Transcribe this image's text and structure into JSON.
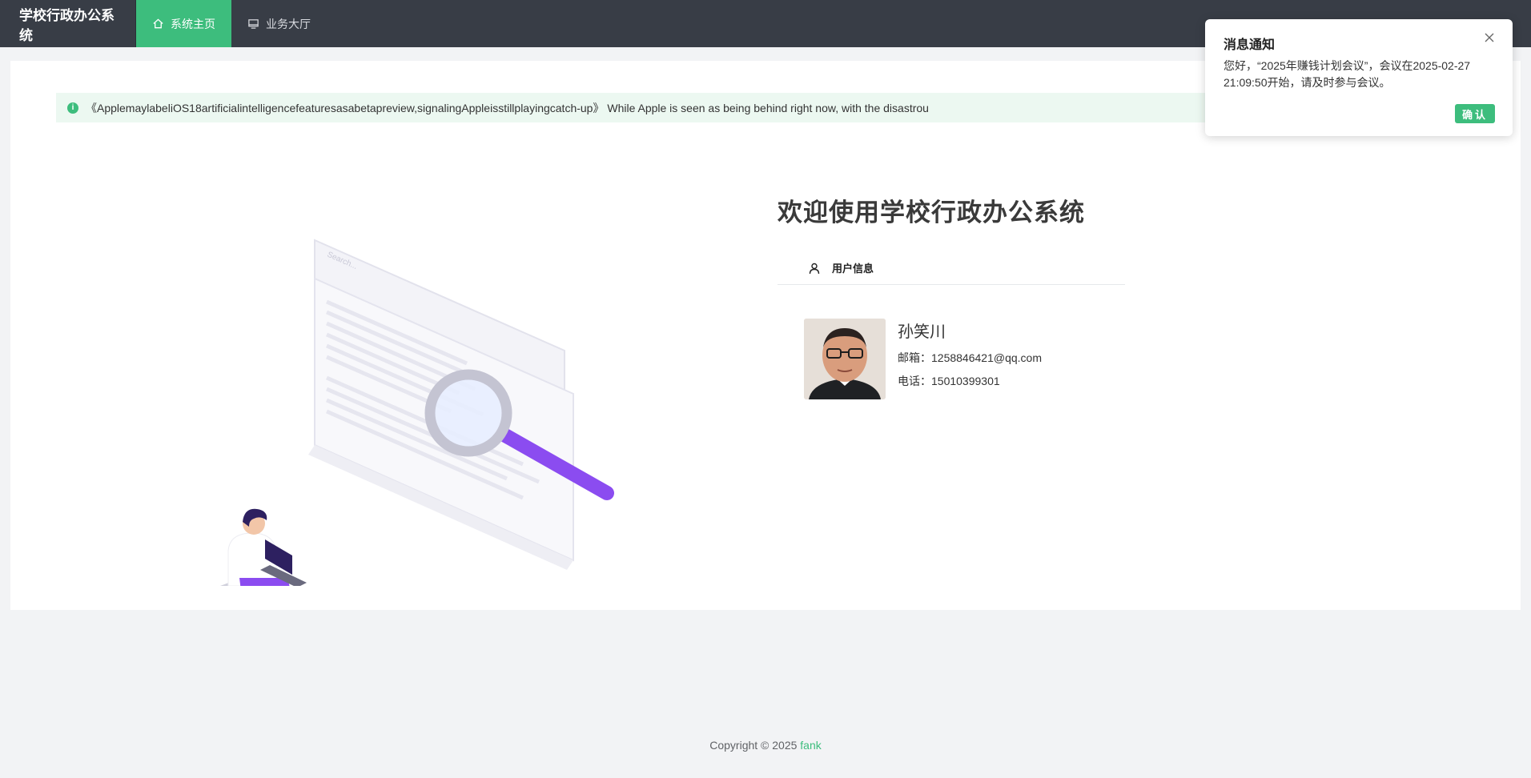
{
  "app": {
    "brand": "学校行政办公系统"
  },
  "nav": [
    {
      "label": "系统主页",
      "icon": "home-icon",
      "active": true
    },
    {
      "label": "业务大厅",
      "icon": "monitor-icon",
      "active": false
    }
  ],
  "alert": {
    "text": "《ApplemaylabeliOS18artificialintelligencefeaturesasabetapreview,signalingAppleisstillplayingcatch-up》 While Apple is seen as being behind right now, with the disastrou"
  },
  "illustration": {
    "search_placeholder": "Search..."
  },
  "welcome": {
    "title": "欢迎使用学校行政办公系统"
  },
  "user_info": {
    "header": "用户信息",
    "name": "孙笑川",
    "email_line": "邮箱：1258846421@qq.com",
    "phone_line": "电话：15010399301"
  },
  "footer": {
    "prefix": "Copyright © 2025",
    "author": "fank"
  },
  "notification": {
    "title": "消息通知",
    "body": "您好，“2025年赚钱计划会议”，会议在2025-02-27 21:09:50开始，请及时参与会议。",
    "confirm_label": "确认"
  },
  "colors": {
    "accent": "#3dbd7d",
    "topbar": "#383d46",
    "illustration_purple": "#8b4cf0"
  }
}
